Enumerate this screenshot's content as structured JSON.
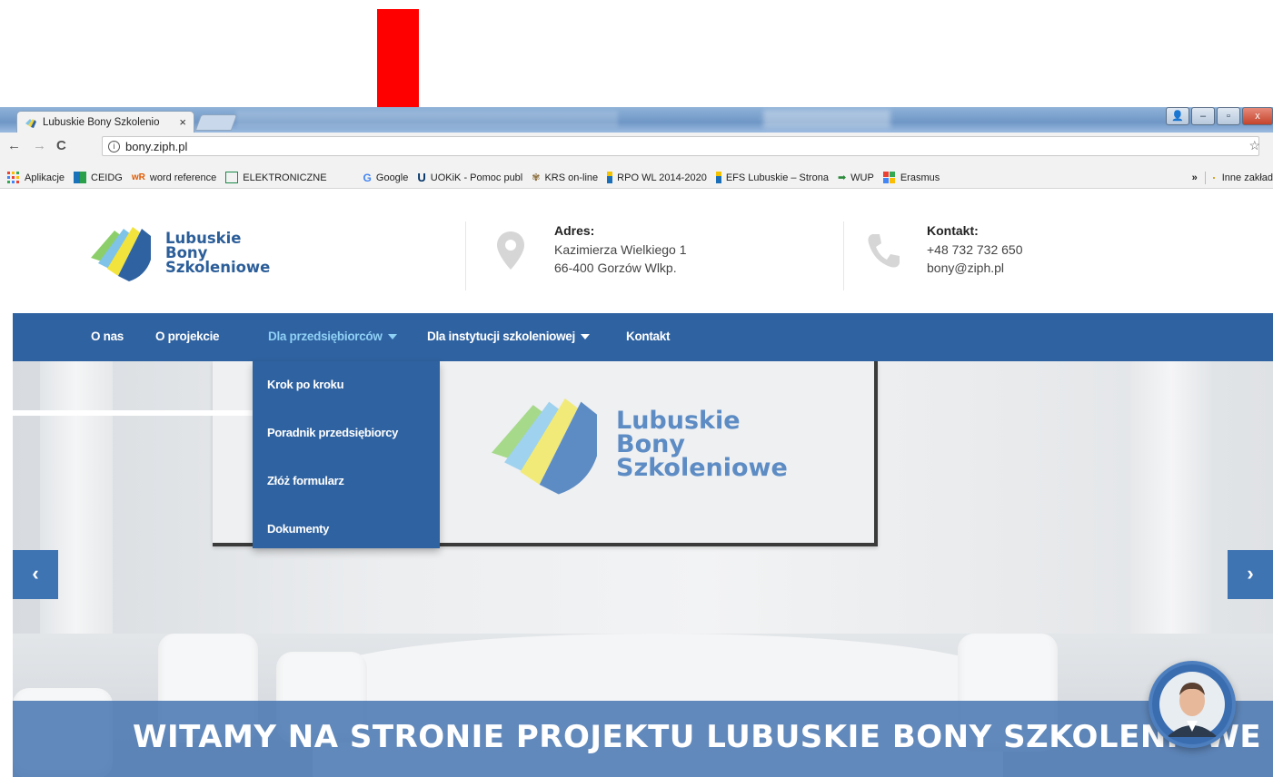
{
  "browser": {
    "tab_title": "Lubuskie Bony Szkolenio",
    "tab_close": "×",
    "url": "bony.ziph.pl",
    "bookmarks": [
      {
        "label": "Aplikacje",
        "icon": "apps-grid-icon",
        "color": "#e94235"
      },
      {
        "label": "CEIDG",
        "icon": "ceidg-icon",
        "color": "#1a73b8"
      },
      {
        "label": "word reference",
        "icon": "wordreference-icon",
        "color": "#e05a00"
      },
      {
        "label": "ELEKTRONICZNE",
        "icon": "eku-icon",
        "color": "#1a8a4a"
      },
      {
        "label": "Google",
        "icon": "google-icon",
        "color": "#4285f4"
      },
      {
        "label": "UOKiK - Pomoc publ",
        "icon": "uokik-icon",
        "color": "#003366"
      },
      {
        "label": "KRS on-line",
        "icon": "krs-icon",
        "color": "#8a6d3b"
      },
      {
        "label": "RPO WL 2014-2020",
        "icon": "rpo-icon",
        "color": "#1a6fb8"
      },
      {
        "label": "EFS Lubuskie – Strona",
        "icon": "efs-icon",
        "color": "#1a6fb8"
      },
      {
        "label": "WUP",
        "icon": "wup-icon",
        "color": "#2a8a3a"
      },
      {
        "label": "Erasmus",
        "icon": "erasmus-icon",
        "color": "#e94235"
      }
    ],
    "more": "»",
    "other_bookmarks": "Inne zakład"
  },
  "header": {
    "logo_lines": [
      "Lubuskie",
      "Bony",
      "Szkoleniowe"
    ],
    "address_label": "Adres:",
    "address_lines": [
      "Kazimierza Wielkiego 1",
      "66-400 Gorzów Wlkp."
    ],
    "contact_label": "Kontakt:",
    "contact_lines": [
      "+48 732 732 650",
      "bony@ziph.pl"
    ]
  },
  "menu": {
    "items": [
      "O nas",
      "O projekcie",
      "Dla przedsiębiorców",
      "Dla instytucji szkoleniowej",
      "Kontakt"
    ],
    "active": "Dla przedsiębiorców"
  },
  "dropdown": {
    "items": [
      "Krok po kroku",
      "Poradnik przedsiębiorcy",
      "Złóż formularz",
      "Dokumenty"
    ]
  },
  "hero": {
    "screen_logo_lines": [
      "Lubuskie",
      "Bony",
      "Szkoleniowe"
    ],
    "prev": "‹",
    "next": "›",
    "title": "WITAMY NA STRONIE PROJEKTU LUBUSKIE BONY SZKOLENIOWE"
  },
  "colors": {
    "brand_blue": "#2f62a0",
    "active_menu": "#8fd0f5",
    "annotation_red": "#ff0000"
  }
}
